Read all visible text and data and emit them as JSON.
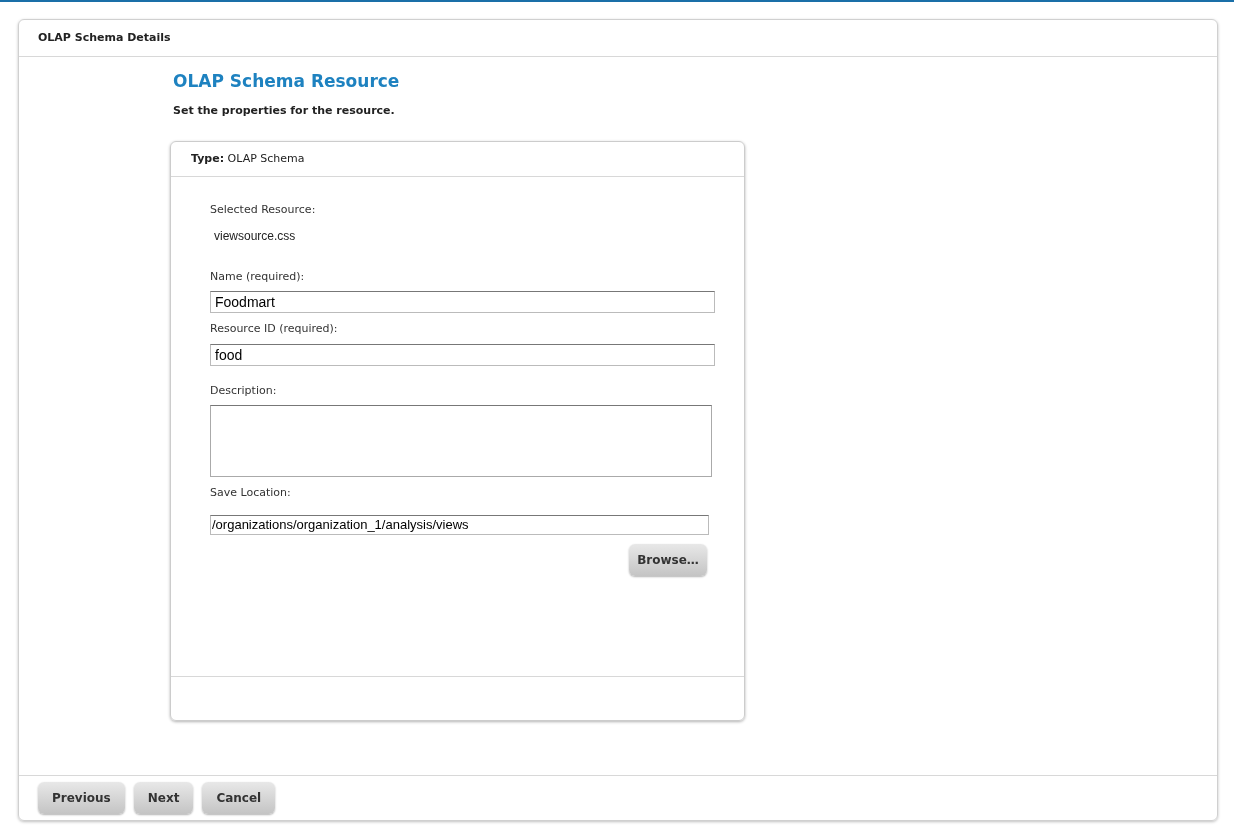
{
  "panel": {
    "title": "OLAP Schema Details"
  },
  "heading": "OLAP Schema Resource",
  "instruction": "Set the properties for the resource.",
  "card": {
    "type_label": "Type:",
    "type_value": "OLAP Schema",
    "selected_resource_label": "Selected Resource:",
    "selected_resource": "viewsource.css",
    "fields": [
      {
        "label": "Name (required):",
        "value": "Foodmart",
        "kind": "input"
      },
      {
        "label": "Resource ID (required):",
        "value": "food",
        "kind": "input"
      },
      {
        "label": "Description:",
        "kind": "textarea"
      },
      {
        "label": "Save Location:",
        "value": "/organizations/organization_1/analysis/views",
        "kind": "input"
      }
    ],
    "browse_button": "Browse…"
  },
  "buttons": [
    "Previous",
    "Next",
    "Cancel"
  ]
}
